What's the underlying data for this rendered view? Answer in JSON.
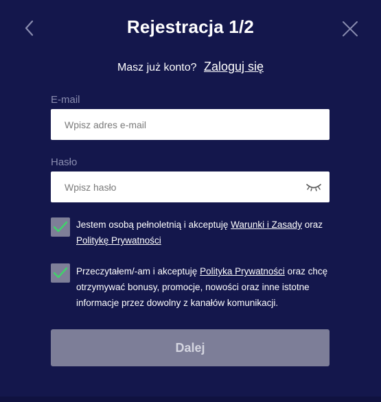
{
  "header": {
    "title": "Rejestracja 1/2",
    "back_icon": "chevron-left-icon",
    "close_icon": "close-icon"
  },
  "login": {
    "question": "Masz już konto?",
    "link": "Zaloguj się"
  },
  "email": {
    "label": "E-mail",
    "placeholder": "Wpisz adres e-mail",
    "value": ""
  },
  "password": {
    "label": "Hasło",
    "placeholder": "Wpisz hasło",
    "value": "",
    "toggle_icon": "eye-closed-icon"
  },
  "consents": [
    {
      "checked": true,
      "text_before": "Jestem osobą pełnoletnią i akceptuję ",
      "link1": "Warunki i Zasady",
      "text_middle": " oraz ",
      "link2": "Politykę Prywatności",
      "text_after": ""
    },
    {
      "checked": true,
      "text_before": "Przeczytałem/-am i akceptuję ",
      "link1": "Polityka Prywatności",
      "text_after": " oraz chcę otrzymywać bonusy, promocje, nowości oraz inne istotne informacje przez dowolny z kanałów komunikacji."
    }
  ],
  "submit": {
    "label": "Dalej"
  },
  "colors": {
    "background": "#14174c",
    "input_bg": "#ffffff",
    "checkbox_bg": "#7e7f98",
    "check_mark": "#3fd46a",
    "button_bg": "#7d7e98",
    "label": "#8a8db0"
  }
}
